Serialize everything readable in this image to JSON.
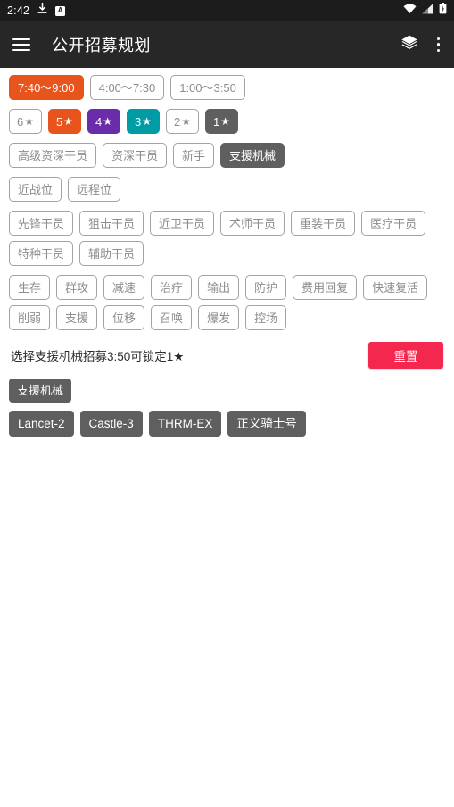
{
  "status_bar": {
    "time": "2:42",
    "icons": [
      "download-icon",
      "app-notification-icon",
      "wifi-icon",
      "signal-icon",
      "battery-icon"
    ],
    "app_badge_letter": "A",
    "background": "#1c1c1c"
  },
  "app_bar": {
    "menu_icon": "hamburger-menu-icon",
    "title": "公开招募规划",
    "layers_icon": "layers-icon",
    "overflow_icon": "overflow-menu-icon",
    "background": "#272727"
  },
  "colors": {
    "accent_orange": "#e8551c",
    "star5": "#e8551c",
    "star4": "#6a2ca8",
    "star3": "#009ca6",
    "selected_gray": "#5f5f5f",
    "reset_red": "#f4274e",
    "unselected_border": "#a3a3a3",
    "unselected_text": "#8d8d8d"
  },
  "filters": {
    "time_options": [
      {
        "label": "7:40〜9:00",
        "selected": true,
        "color": "#e8551c"
      },
      {
        "label": "4:00〜7:30",
        "selected": false,
        "color": ""
      },
      {
        "label": "1:00〜3:50",
        "selected": false,
        "color": ""
      }
    ],
    "rarity_options": [
      {
        "label": "6",
        "star": "★",
        "selected": false,
        "color": ""
      },
      {
        "label": "5",
        "star": "★",
        "selected": true,
        "color": "#e8551c"
      },
      {
        "label": "4",
        "star": "★",
        "selected": true,
        "color": "#6a2ca8"
      },
      {
        "label": "3",
        "star": "★",
        "selected": true,
        "color": "#009ca6"
      },
      {
        "label": "2",
        "star": "★",
        "selected": false,
        "color": ""
      },
      {
        "label": "1",
        "star": "★",
        "selected": true,
        "color": "#5f5f5f"
      }
    ],
    "qualification_options": [
      {
        "label": "高级资深干员",
        "selected": false,
        "color": ""
      },
      {
        "label": "资深干员",
        "selected": false,
        "color": ""
      },
      {
        "label": "新手",
        "selected": false,
        "color": ""
      },
      {
        "label": "支援机械",
        "selected": true,
        "color": "#5f5f5f"
      }
    ],
    "position_options": [
      {
        "label": "近战位",
        "selected": false,
        "color": ""
      },
      {
        "label": "远程位",
        "selected": false,
        "color": ""
      }
    ],
    "profession_options": [
      {
        "label": "先锋干员",
        "selected": false,
        "color": ""
      },
      {
        "label": "狙击干员",
        "selected": false,
        "color": ""
      },
      {
        "label": "近卫干员",
        "selected": false,
        "color": ""
      },
      {
        "label": "术师干员",
        "selected": false,
        "color": ""
      },
      {
        "label": "重装干员",
        "selected": false,
        "color": ""
      },
      {
        "label": "医疗干员",
        "selected": false,
        "color": ""
      },
      {
        "label": "特种干员",
        "selected": false,
        "color": ""
      },
      {
        "label": "辅助干员",
        "selected": false,
        "color": ""
      }
    ],
    "tag_options": [
      {
        "label": "生存",
        "selected": false,
        "color": ""
      },
      {
        "label": "群攻",
        "selected": false,
        "color": ""
      },
      {
        "label": "减速",
        "selected": false,
        "color": ""
      },
      {
        "label": "治疗",
        "selected": false,
        "color": ""
      },
      {
        "label": "输出",
        "selected": false,
        "color": ""
      },
      {
        "label": "防护",
        "selected": false,
        "color": ""
      },
      {
        "label": "费用回复",
        "selected": false,
        "color": ""
      },
      {
        "label": "快速复活",
        "selected": false,
        "color": ""
      },
      {
        "label": "削弱",
        "selected": false,
        "color": ""
      },
      {
        "label": "支援",
        "selected": false,
        "color": ""
      },
      {
        "label": "位移",
        "selected": false,
        "color": ""
      },
      {
        "label": "召唤",
        "selected": false,
        "color": ""
      },
      {
        "label": "爆发",
        "selected": false,
        "color": ""
      },
      {
        "label": "控场",
        "selected": false,
        "color": ""
      }
    ]
  },
  "result": {
    "summary_text": "选择支援机械招募3:50可锁定1★",
    "reset_label": "重置",
    "combo_tags": [
      "支援机械"
    ],
    "operators": [
      "Lancet-2",
      "Castle-3",
      "THRM-EX",
      "正义骑士号"
    ]
  }
}
